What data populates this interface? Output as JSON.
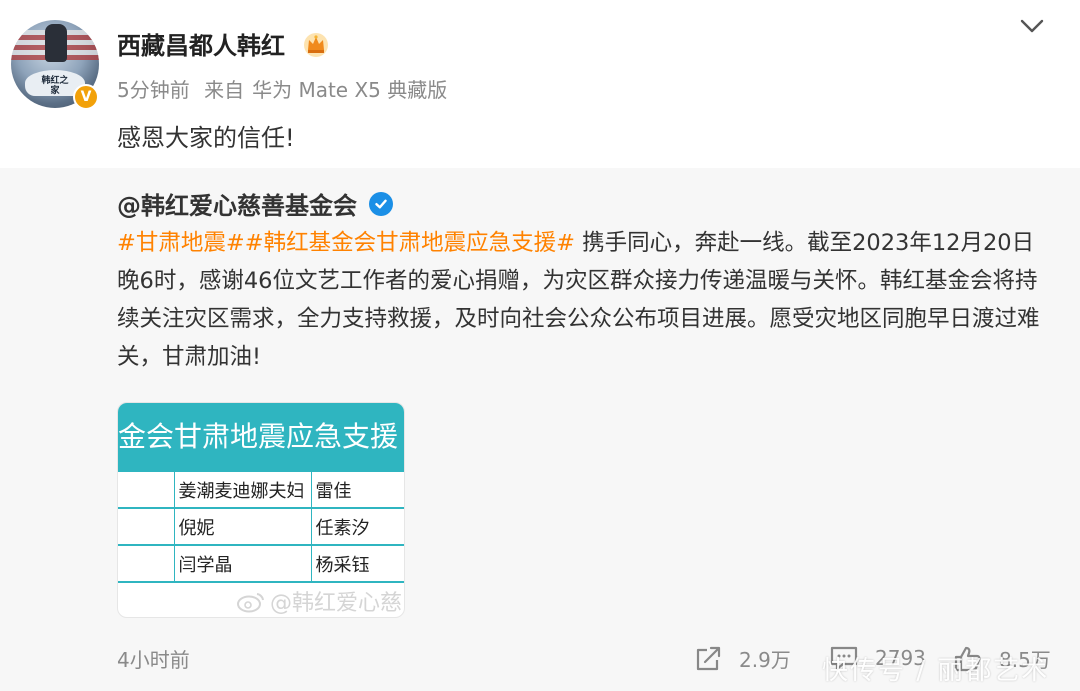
{
  "post": {
    "author": "西藏昌都人韩红",
    "time_ago": "5分钟前",
    "source_prefix": "来自",
    "device": "华为 Mate X5 典藏版",
    "text": "感恩大家的信任!",
    "avatar_text": "韩红之家",
    "verified_label": "V"
  },
  "repost": {
    "org": "@韩红爱心慈善基金会",
    "hashtag1": "#甘肃地震#",
    "hashtag2": "#韩红基金会甘肃地震应急支援#",
    "body": " 携手同心，奔赴一线。截至2023年12月20日晚6时，感谢46位文艺工作者的爱心捐赠，为灾区群众接力传递温暖与关怀。韩红基金会将持续关注灾区需求，全力支持救援，及时向社会公众公布项目进展。愿受灾地区同胞早日渡过难关，甘肃加油!",
    "image": {
      "header": "金会甘肃地震应急支援",
      "rows": [
        [
          "",
          "姜潮麦迪娜夫妇",
          "雷佳"
        ],
        [
          "",
          "倪妮",
          "任素汐"
        ],
        [
          "",
          "闫学晶",
          "杨采钰"
        ]
      ],
      "watermark": "@韩红爱心慈"
    },
    "time": "4小时前",
    "shares": "2.9万",
    "comments": "2793",
    "likes": "8.5万"
  },
  "site_watermark": "快传号 / 丽都艺术",
  "colors": {
    "hashtag": "#ff8200",
    "image_accent": "#2fb5c0",
    "verified_blue": "#1b8fe6",
    "verified_orange": "#f2a10a"
  }
}
